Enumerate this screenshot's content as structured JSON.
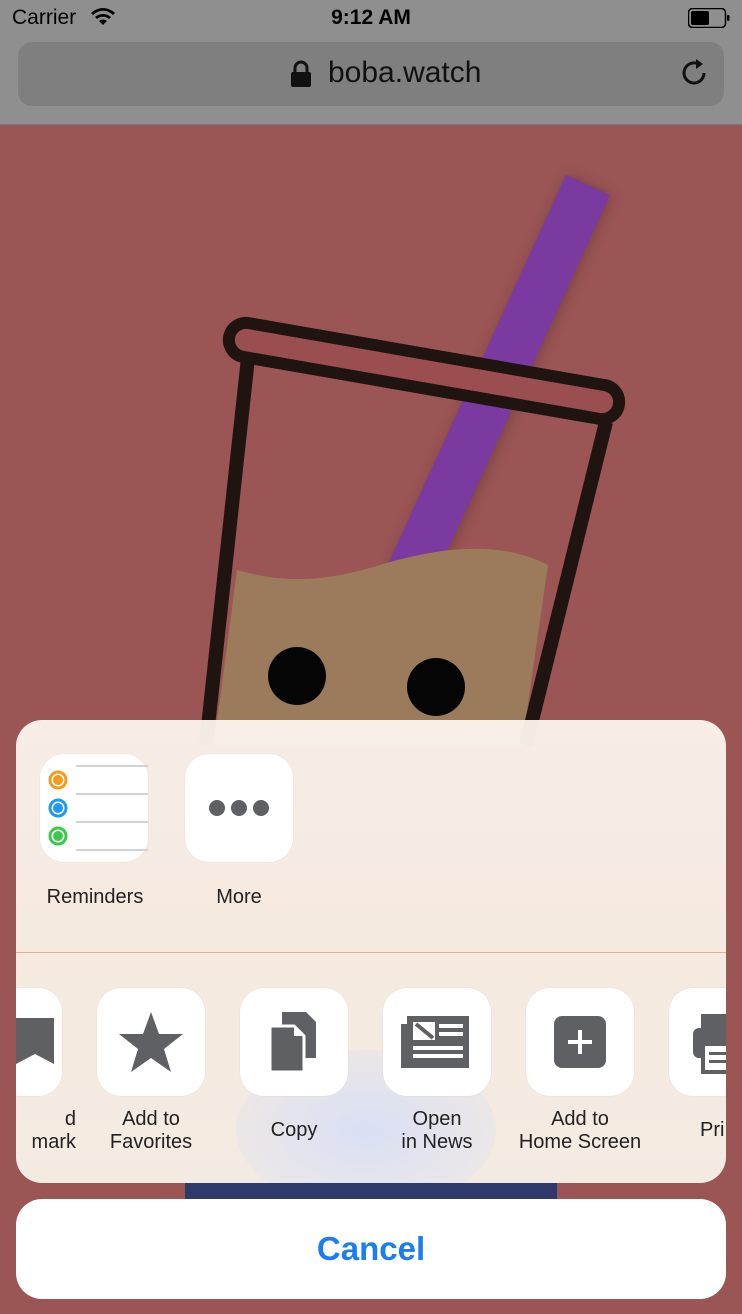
{
  "status": {
    "carrier": "Carrier",
    "time": "9:12 AM"
  },
  "browser": {
    "url": "boba.watch"
  },
  "colors": {
    "accent": "#1a7ef0",
    "page_bg": "#9a5554",
    "straw": "#7a3aa0"
  },
  "share": {
    "apps": [
      {
        "label": "Reminders",
        "icon": "reminders-icon"
      },
      {
        "label": "More",
        "icon": "more-icon"
      }
    ],
    "actions": [
      {
        "label": "d\nmark",
        "icon": "bookmark-icon"
      },
      {
        "label": "Add to\nFavorites",
        "icon": "star-icon"
      },
      {
        "label": "Copy",
        "icon": "copy-icon"
      },
      {
        "label": "Open\nin News",
        "icon": "news-icon"
      },
      {
        "label": "Add to\nHome Screen",
        "icon": "plus-square-icon"
      },
      {
        "label": "Pri",
        "icon": "print-icon"
      }
    ],
    "cancel_label": "Cancel"
  }
}
